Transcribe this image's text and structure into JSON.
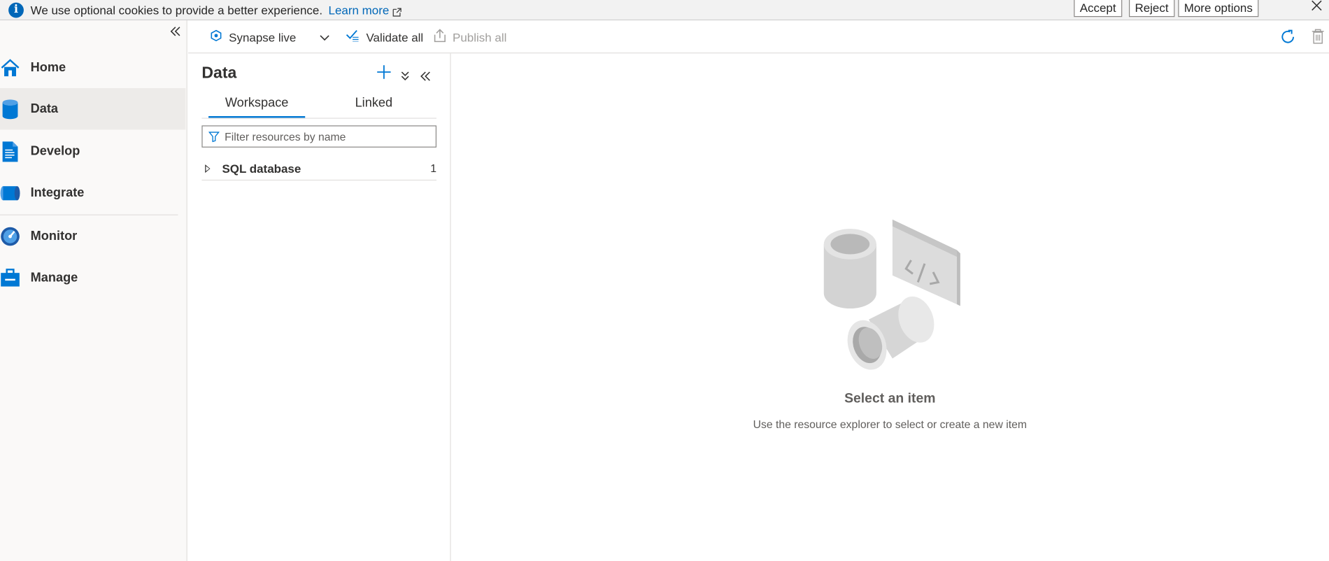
{
  "cookie_banner": {
    "message": "We use optional cookies to provide a better experience.",
    "learn_more": "Learn more",
    "accept": "Accept",
    "reject": "Reject",
    "more_options": "More options"
  },
  "nav": {
    "items": [
      {
        "label": "Home",
        "icon": "home-icon"
      },
      {
        "label": "Data",
        "icon": "database-icon"
      },
      {
        "label": "Develop",
        "icon": "document-icon"
      },
      {
        "label": "Integrate",
        "icon": "pipeline-icon"
      },
      {
        "label": "Monitor",
        "icon": "gauge-icon"
      },
      {
        "label": "Manage",
        "icon": "toolbox-icon"
      }
    ],
    "active": "Data"
  },
  "toolbar": {
    "workspace_mode": "Synapse live",
    "validate_all": "Validate all",
    "publish_all": "Publish all"
  },
  "data_panel": {
    "title": "Data",
    "tabs": [
      {
        "label": "Workspace",
        "selected": true
      },
      {
        "label": "Linked",
        "selected": false
      }
    ],
    "filter_placeholder": "Filter resources by name",
    "tree": [
      {
        "label": "SQL database",
        "count": "1"
      }
    ]
  },
  "empty_state": {
    "title": "Select an item",
    "subtitle": "Use the resource explorer to select or create a new item"
  },
  "colors": {
    "accent": "#0078d4",
    "nav_active_bg": "#edebe9"
  }
}
